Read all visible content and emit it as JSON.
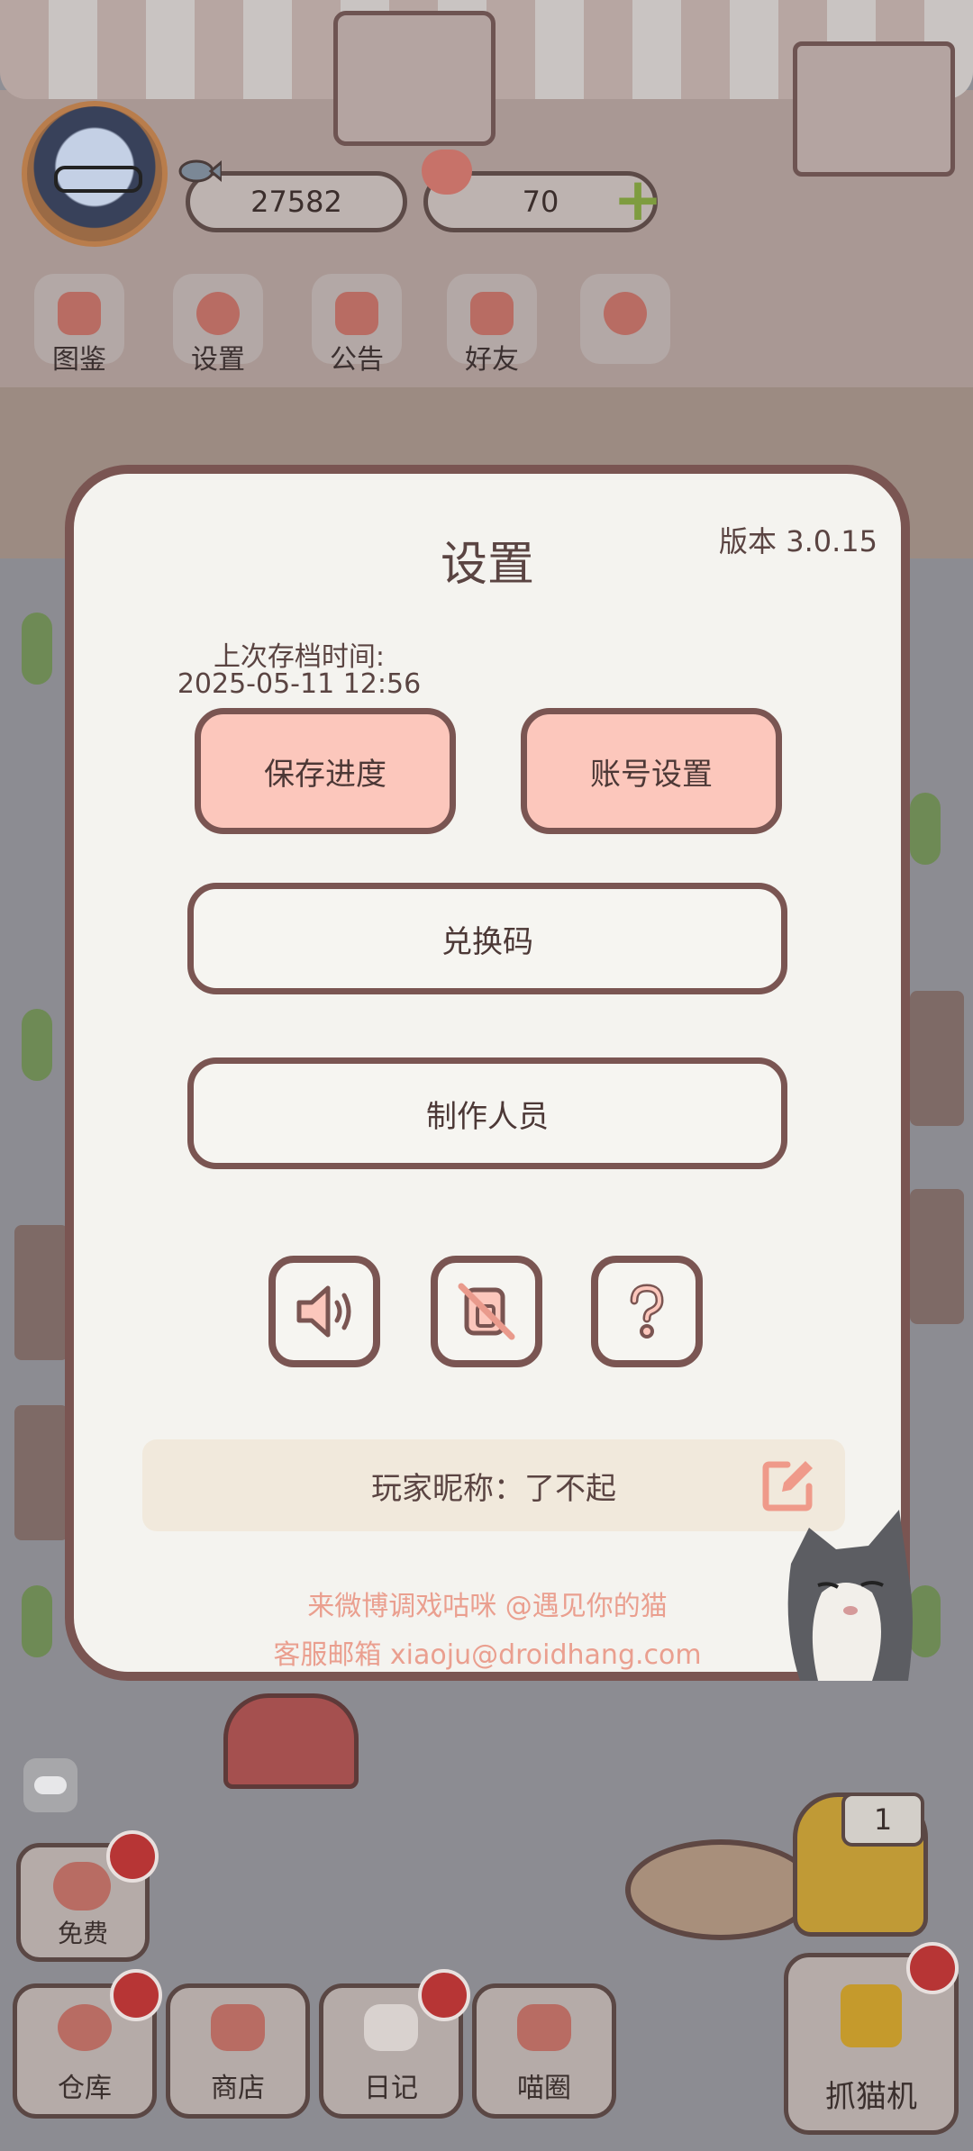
{
  "hud": {
    "coins": "27582",
    "hearts": "70",
    "menu": [
      {
        "label": "图鉴",
        "icon": "cat-book-icon"
      },
      {
        "label": "设置",
        "icon": "gear-icon"
      },
      {
        "label": "公告",
        "icon": "gift-icon"
      },
      {
        "label": "好友",
        "icon": "friends-icon"
      },
      {
        "label": "",
        "icon": "hearts-notice-icon"
      }
    ]
  },
  "dialog": {
    "title": "设置",
    "version": "版本 3.0.15",
    "last_save_label": "上次存档时间:",
    "last_save_time": "2025-05-11 12:56",
    "save_button": "保存进度",
    "account_button": "账号设置",
    "redeem_button": "兑换码",
    "credits_button": "制作人员",
    "icon_buttons": [
      "sound-on-icon",
      "vibration-off-icon",
      "help-icon"
    ],
    "nickname_text": "玩家昵称：了不起",
    "footer_weibo": "来微博调戏咕咪 @遇见你的猫",
    "footer_email": "客服邮箱 xiaoju@droidhang.com"
  },
  "dock": {
    "free": "免费",
    "items": [
      "仓库",
      "商店",
      "日记",
      "喵圈"
    ],
    "claw": "抓猫机",
    "machine_count": "1"
  },
  "colors": {
    "dialog_border": "#7a5552",
    "pink_button": "#fcc7bc",
    "footer_text": "#ea9f8f",
    "dim_overlay": "#8c8c92"
  }
}
